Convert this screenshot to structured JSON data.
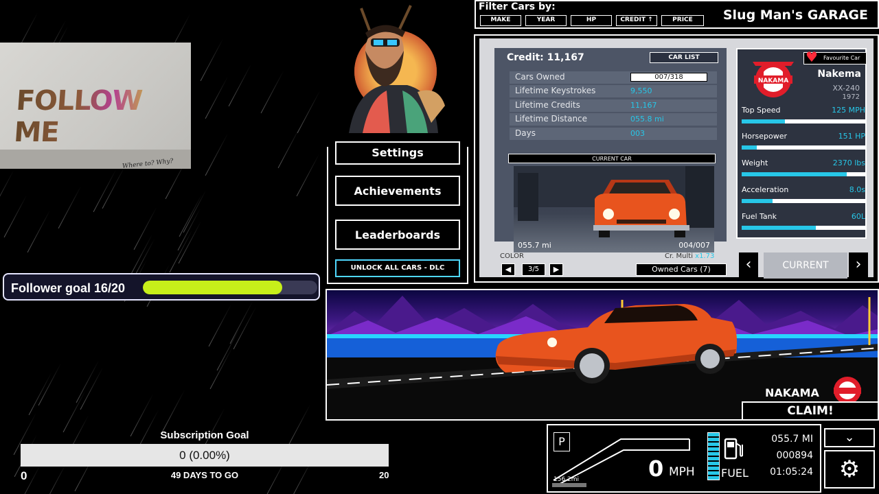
{
  "stream": {
    "follower_goal": {
      "label": "Follower goal 16/20",
      "current": 16,
      "target": 20
    },
    "subscription_goal": {
      "title": "Subscription Goal",
      "value_text": "0 (0.00%)",
      "min": "0",
      "max": "20",
      "days_left": "49 DAYS TO GO",
      "progress": 0.0
    },
    "photo": {
      "graffiti": "FOLLOW ME",
      "scribble": "Where to? Why?"
    }
  },
  "menu": {
    "buttons": [
      {
        "label": "Settings"
      },
      {
        "label": "Achievements"
      },
      {
        "label": "Leaderboards"
      },
      {
        "label": "UNLOCK ALL CARS - DLC"
      }
    ]
  },
  "filter": {
    "title": "Filter Cars by:",
    "options": [
      "MAKE",
      "YEAR",
      "HP",
      "CREDIT ↑",
      "PRICE"
    ],
    "garage_title": "Slug Man's GARAGE"
  },
  "garage": {
    "credit": "Credit: 11,167",
    "car_list_label": "CAR LIST",
    "stats": [
      {
        "label": "Cars Owned",
        "value": "007/318"
      },
      {
        "label": "Lifetime Keystrokes",
        "value": "9,550"
      },
      {
        "label": "Lifetime Credits",
        "value": "11,167"
      },
      {
        "label": "Lifetime Distance",
        "value": "055.8 mi"
      },
      {
        "label": "Days",
        "value": "003"
      }
    ],
    "current_car_label": "CURRENT CAR",
    "car_miles": "055.7 mi",
    "car_index": "004/007",
    "color_label": "COLOR",
    "color_value": "3/5",
    "cr_multi_label": "Cr. Multi",
    "cr_multi_value": "x1.73",
    "owned_cars": "Owned Cars (7)",
    "favourite_label": "Favourite Car",
    "make": "Nakema",
    "model": "XX-240",
    "year": "1972",
    "logo_text": "NAKAMA",
    "specs": [
      {
        "label": "Top Speed",
        "value": "125 MPH",
        "level": 0.35
      },
      {
        "label": "Horsepower",
        "value": "151 HP",
        "level": 0.12
      },
      {
        "label": "Weight",
        "value": "2370 lbs",
        "level": 0.85
      },
      {
        "label": "Acceleration",
        "value": "8.0s",
        "level": 0.25
      },
      {
        "label": "Fuel Tank",
        "value": "60L",
        "level": 0.6
      }
    ],
    "nav_prev": "‹",
    "nav_current": "CURRENT",
    "nav_next": "›"
  },
  "scene": {
    "brand": "NAKAMA",
    "claim": "CLAIM!"
  },
  "dashboard": {
    "gear": "P",
    "speed": "0",
    "speed_unit": "MPH",
    "tach_label": "156.2mi",
    "fuel_label": "FUEL",
    "trip": "055.7 MI",
    "odometer": "000894",
    "time": "01:05:24",
    "chevron": "⌄",
    "settings_icon": "⚙"
  },
  "colors": {
    "accent": "#27c7e8",
    "goal_fill": "#c7ef1a",
    "heart": "#ff2b3a",
    "car": "#e8541e"
  }
}
